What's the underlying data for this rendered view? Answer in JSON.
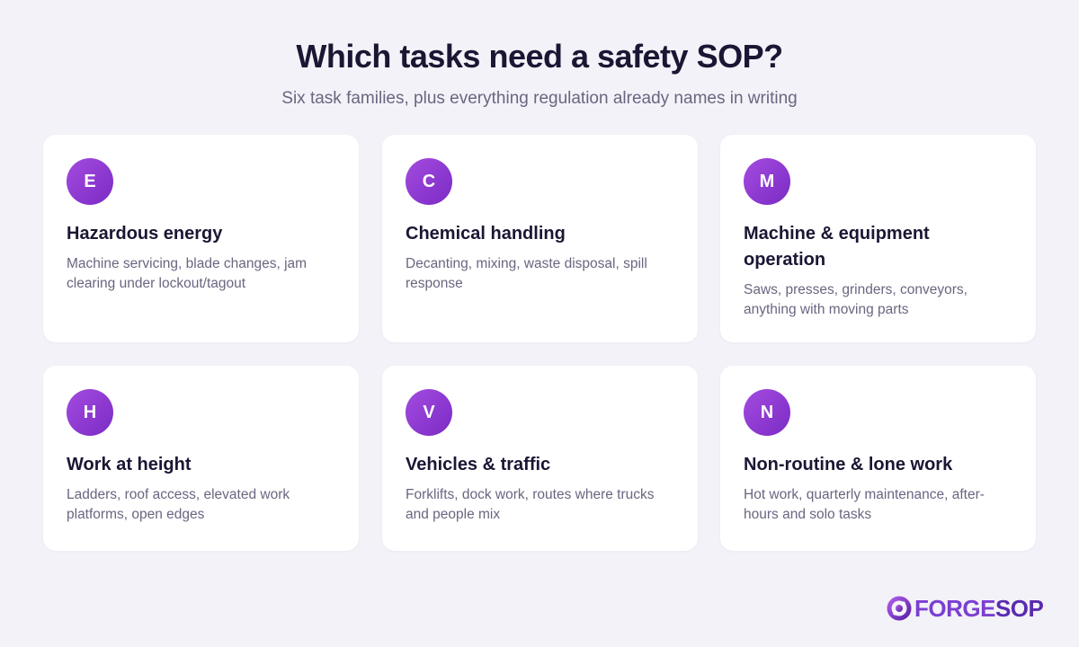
{
  "header": {
    "title": "Which tasks need a safety SOP?",
    "subtitle": "Six task families, plus everything regulation already names in writing"
  },
  "cards": [
    {
      "letter": "E",
      "title": "Hazardous energy",
      "description": "Machine servicing, blade changes, jam clearing under lockout/tagout"
    },
    {
      "letter": "C",
      "title": "Chemical handling",
      "description": "Decanting, mixing, waste disposal, spill response"
    },
    {
      "letter": "M",
      "title": "Machine & equipment operation",
      "description": "Saws, presses, grinders, conveyors, anything with moving parts"
    },
    {
      "letter": "H",
      "title": "Work at height",
      "description": "Ladders, roof access, elevated work platforms, open edges"
    },
    {
      "letter": "V",
      "title": "Vehicles & traffic",
      "description": "Forklifts, dock work, routes where trucks and people mix"
    },
    {
      "letter": "N",
      "title": "Non-routine & lone work",
      "description": "Hot work, quarterly maintenance, after-hours and solo tasks"
    }
  ],
  "brand": {
    "name_part1": "FORGE",
    "name_part2": "SOP",
    "icon": "forgesop-logo-icon"
  },
  "colors": {
    "background": "#f3f2f8",
    "card": "#ffffff",
    "accent_start": "#a44be0",
    "accent_end": "#7a2bc4",
    "title_text": "#1b1633",
    "body_text": "#6b6580"
  }
}
